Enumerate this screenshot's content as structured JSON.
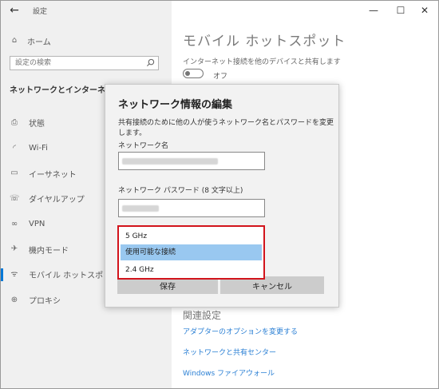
{
  "window": {
    "title": "設定",
    "back_icon": "back-arrow-icon"
  },
  "sidebar": {
    "home_label": "ホーム",
    "search_placeholder": "設定の検索",
    "section_title": "ネットワークとインターネット",
    "items": [
      {
        "label": "状態",
        "icon": "status-icon",
        "active": false
      },
      {
        "label": "Wi-Fi",
        "icon": "wifi-icon",
        "active": false
      },
      {
        "label": "イーサネット",
        "icon": "ethernet-icon",
        "active": false
      },
      {
        "label": "ダイヤルアップ",
        "icon": "dialup-icon",
        "active": false
      },
      {
        "label": "VPN",
        "icon": "vpn-icon",
        "active": false
      },
      {
        "label": "機内モード",
        "icon": "airplane-icon",
        "active": false
      },
      {
        "label": "モバイル ホットスポット",
        "icon": "hotspot-icon",
        "active": true
      },
      {
        "label": "プロキシ",
        "icon": "proxy-icon",
        "active": false
      }
    ]
  },
  "main": {
    "title": "モバイル ホットスポット",
    "share_label": "インターネット接続を他のデバイスと共有します",
    "toggle_state": "オフ",
    "related_title": "関連設定",
    "related_links": [
      "アダプターのオプションを変更する",
      "ネットワークと共有センター",
      "Windows ファイアウォール"
    ]
  },
  "dialog": {
    "title": "ネットワーク情報の編集",
    "description": "共有接続のために他の人が使うネットワーク名とパスワードを変更します。",
    "name_label": "ネットワーク名",
    "password_label": "ネットワーク パスワード (8 文字以上)",
    "band_options": [
      "5 GHz",
      "使用可能な接続",
      "2.4 GHz"
    ],
    "band_selected": "使用可能な接続",
    "save_label": "保存",
    "cancel_label": "キャンセル"
  },
  "colors": {
    "accent": "#0078d7",
    "highlight": "#99c8f0",
    "annotation_red": "#d2141c",
    "link": "#2a7fd4"
  }
}
